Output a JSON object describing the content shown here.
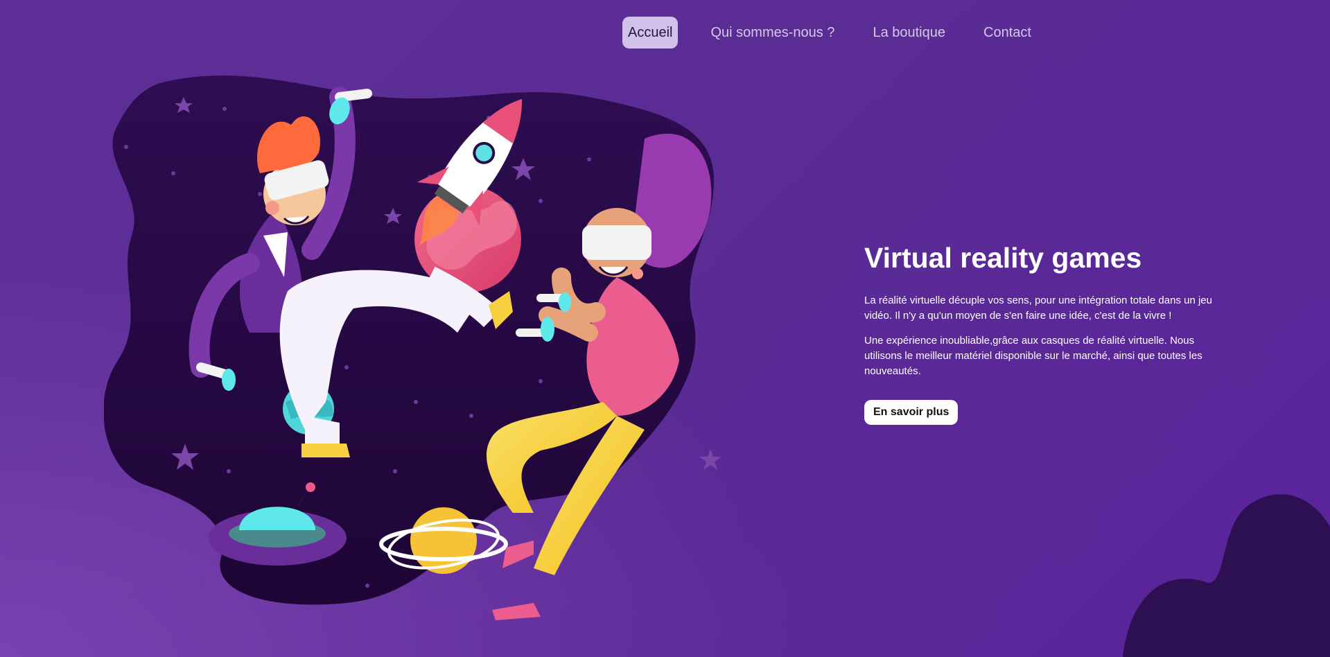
{
  "nav": {
    "items": [
      {
        "label": "Accueil",
        "active": true
      },
      {
        "label": "Qui sommes-nous ?",
        "active": false
      },
      {
        "label": "La boutique",
        "active": false
      },
      {
        "label": "Contact",
        "active": false
      }
    ]
  },
  "hero": {
    "title": "Virtual reality games",
    "paragraph_1": "La réalité virtuelle décuple vos sens, pour une intégration totale dans un jeu vidéo. Il n'y a qu'un moyen de s'en faire une idée, c'est de la vivre !",
    "paragraph_2": "Une expérience inoubliable,grâce aux casques de réalité virtuelle. Nous utilisons le meilleur matériel disponible sur le marché, ainsi que toutes les nouveautés.",
    "cta_label": "En savoir plus"
  },
  "illustration": {
    "subject": "vr-players-in-space-illustration",
    "colors": {
      "space": "#24093f",
      "planet_pink": "#e8507a",
      "planet_teal": "#4fd6d8",
      "planet_yellow": "#f6c336",
      "pants_yellow": "#f5d13c",
      "shirt_pink": "#ec5d8f",
      "suit_purple": "#6a2e9a",
      "hair_orange": "#ff6a3d"
    }
  }
}
